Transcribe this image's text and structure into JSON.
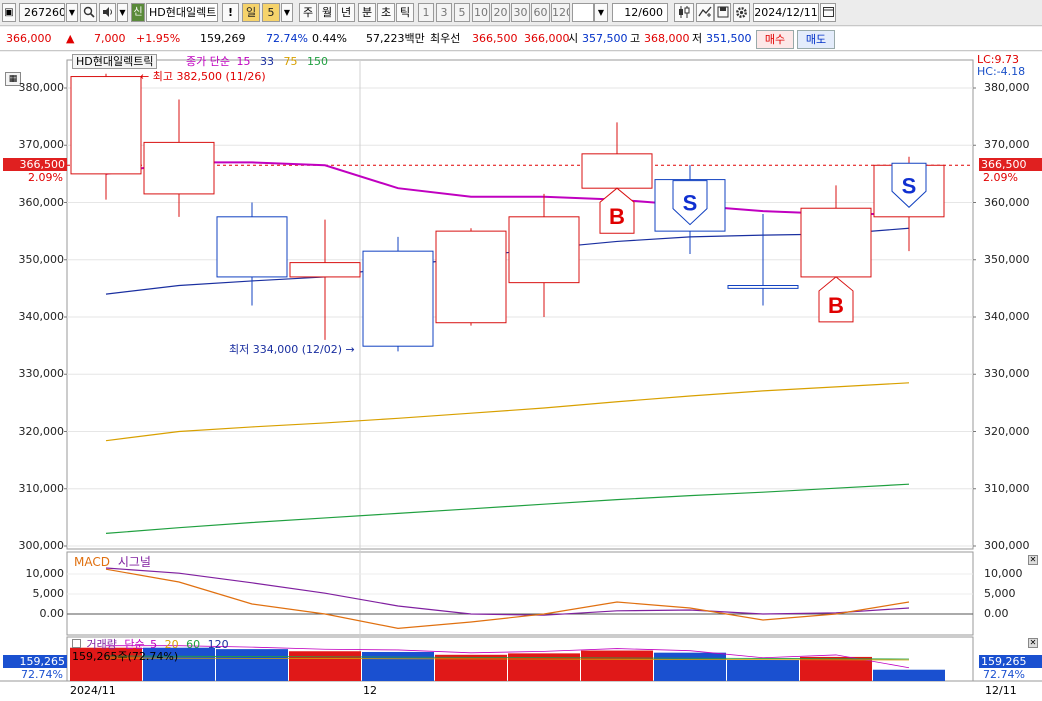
{
  "toolbar": {
    "code": "267260",
    "name_badge": "신",
    "stock_name": "HD현대일렉트릭",
    "warn": "!",
    "period_day": "일",
    "period_num": "5",
    "periods": [
      "주",
      "월",
      "년",
      "분",
      "초",
      "틱"
    ],
    "counts": [
      "1",
      "3",
      "5",
      "10",
      "20",
      "30",
      "60",
      "120"
    ],
    "range": "12",
    "range_total": "/600",
    "date": "2024/12/11"
  },
  "quote": {
    "price": "366,000",
    "arrow": "▲",
    "change": "7,000",
    "change_pct": "+1.95%",
    "volume": "159,269",
    "vol_ratio": "72.74%",
    "turnover": "0.44%",
    "amount": "57,223백만",
    "best_label": "최우선",
    "best_ask": "366,500",
    "best_bid": "366,000",
    "open_label": "시",
    "open": "357,500",
    "high_label": "고",
    "high": "368,000",
    "low_label": "저",
    "low": "351,500",
    "buy_label": "매수",
    "sell_label": "매도"
  },
  "legend": {
    "stock": "HD현대일렉트릭",
    "ma_label": "종가 단순",
    "ma_periods": [
      "15",
      "33",
      "75",
      "150"
    ],
    "ma_colors": [
      "#c000c0",
      "#1a2fa0",
      "#d8a000",
      "#20a040"
    ]
  },
  "corner": {
    "lc": "LC:9.73",
    "hc": "HC:-4.18"
  },
  "price_tag": {
    "value": "366,500",
    "pct": "2.09%"
  },
  "annotations": {
    "high": "최고 382,500 (11/26)",
    "low": "최저 334,000 (12/02)"
  },
  "signals": {
    "buy": "B",
    "sell": "S"
  },
  "macd": {
    "label_macd": "MACD",
    "label_signal": "시그널",
    "ticks": [
      "10,000",
      "5,000",
      "0.00"
    ]
  },
  "volume_panel": {
    "label": "거래량",
    "ma_label": "단순",
    "ma_periods": [
      "5",
      "20",
      "60",
      "120"
    ],
    "ma_colors": [
      "#c000c0",
      "#d8a000",
      "#20a040",
      "#1a2fa0"
    ],
    "info": "159,265주(72.74%)",
    "tag_value": "159,265",
    "tag_pct": "72.74%"
  },
  "xaxis": {
    "labels": [
      "2024/11",
      "12",
      "12/11"
    ]
  },
  "chart_data": {
    "type": "candlestick",
    "yticks": [
      "380,000",
      "370,000",
      "360,000",
      "350,000",
      "340,000",
      "330,000",
      "320,000",
      "310,000",
      "300,000"
    ],
    "ylim": [
      300000,
      383000
    ],
    "candles": [
      {
        "o": 365000,
        "c": 382000,
        "h": 382500,
        "l": 360500
      },
      {
        "o": 361500,
        "c": 370500,
        "h": 378000,
        "l": 357500
      },
      {
        "o": 357500,
        "c": 347000,
        "h": 360000,
        "l": 342000
      },
      {
        "o": 347000,
        "c": 349500,
        "h": 357000,
        "l": 336000
      },
      {
        "o": 351500,
        "c": 334900,
        "h": 354000,
        "l": 334000
      },
      {
        "o": 339000,
        "c": 355000,
        "h": 355500,
        "l": 338500
      },
      {
        "o": 346000,
        "c": 357500,
        "h": 361500,
        "l": 340000
      },
      {
        "o": 362500,
        "c": 368500,
        "h": 374000,
        "l": 355000
      },
      {
        "o": 364000,
        "c": 355000,
        "h": 366500,
        "l": 351000
      },
      {
        "o": 345500,
        "c": 345000,
        "h": 358000,
        "l": 342000
      },
      {
        "o": 347000,
        "c": 359000,
        "h": 363000,
        "l": 345000
      },
      {
        "o": 357500,
        "c": 366500,
        "h": 368000,
        "l": 351500
      }
    ],
    "ma15": [
      365000,
      367000,
      367000,
      366500,
      362500,
      361000,
      361000,
      360500,
      359500,
      358500,
      358000,
      358000
    ],
    "ma33": [
      344000,
      345500,
      346300,
      347000,
      348800,
      350500,
      352000,
      353200,
      354000,
      354300,
      354500,
      355500
    ],
    "ma75": [
      318400,
      320000,
      320800,
      321500,
      322300,
      323200,
      324100,
      325200,
      326200,
      327100,
      327800,
      328500
    ],
    "ma150": [
      302200,
      303200,
      304100,
      304900,
      305700,
      306500,
      307300,
      308100,
      308800,
      309400,
      310100,
      310800
    ],
    "signals": [
      {
        "idx": 7,
        "type": "B"
      },
      {
        "idx": 8,
        "type": "S"
      },
      {
        "idx": 10,
        "type": "B"
      },
      {
        "idx": 11,
        "type": "S"
      }
    ],
    "macd": {
      "ylim": [
        -6000,
        13000
      ],
      "macd": [
        11200,
        8000,
        2500,
        0,
        -3600,
        -2000,
        0,
        3000,
        1500,
        -1500,
        0,
        3000
      ],
      "signal": [
        11500,
        10200,
        7800,
        5200,
        2000,
        0,
        -300,
        800,
        1000,
        0,
        300,
        1500
      ]
    },
    "volume": {
      "ylim": [
        0,
        480000
      ],
      "values": [
        470000,
        470000,
        450000,
        420000,
        410000,
        370000,
        390000,
        430000,
        400000,
        300000,
        340000,
        159265
      ],
      "colors": [
        "red",
        "blue",
        "blue",
        "red",
        "blue",
        "red",
        "red",
        "red",
        "blue",
        "blue",
        "red",
        "blue"
      ]
    }
  }
}
